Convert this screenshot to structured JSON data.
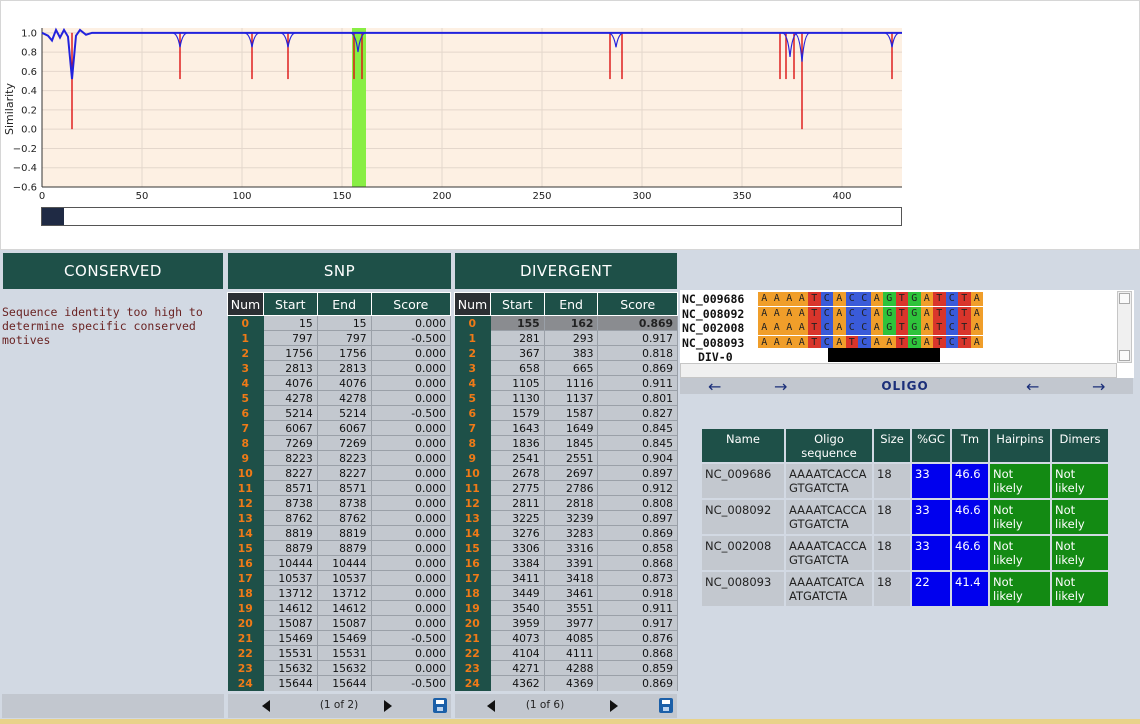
{
  "chart": {
    "ylabel": "Similarity",
    "y_ticks": [
      "1.0",
      "0.8",
      "0.6",
      "0.4",
      "0.2",
      "0.0",
      "−0.2",
      "−0.4",
      "−0.6"
    ],
    "x_ticks": [
      "0",
      "50",
      "100",
      "150",
      "200",
      "250",
      "300",
      "350",
      "400"
    ],
    "colors": {
      "plot_bg": "#fdf0e3",
      "line": "#2222dd",
      "spikes": "#dd1111",
      "highlight": "#88ee44"
    }
  },
  "chart_data": {
    "type": "line",
    "xlim": [
      0,
      430
    ],
    "ylim": [
      -0.6,
      1.05
    ],
    "grid": true,
    "highlight_range": [
      155,
      162
    ],
    "series": [
      {
        "kind": "line",
        "x": [
          0,
          3,
          5,
          7,
          9,
          11,
          13,
          15,
          17,
          19,
          22,
          25,
          430
        ],
        "values": [
          1.0,
          0.97,
          0.92,
          1.03,
          0.95,
          1.03,
          0.96,
          0.52,
          0.97,
          1.03,
          0.98,
          1.0,
          1.0
        ]
      },
      {
        "kind": "spikes",
        "x": [
          15,
          69,
          105,
          123,
          156,
          160,
          284,
          290,
          369,
          372,
          376,
          380,
          425
        ],
        "values": [
          0.0,
          0.52,
          0.52,
          0.52,
          0.52,
          0.52,
          0.52,
          0.52,
          0.52,
          0.52,
          0.52,
          0.0,
          0.52
        ]
      },
      {
        "kind": "dips",
        "x": [
          69,
          105,
          123,
          158,
          287,
          374,
          380,
          425
        ],
        "values": [
          0.85,
          0.85,
          0.85,
          0.8,
          0.85,
          0.75,
          0.7,
          0.85
        ]
      }
    ]
  },
  "sections": {
    "conserved": "CONSERVED",
    "snp": "SNP",
    "divergent": "DIVERGENT"
  },
  "conserved_note": "Sequence identity too high to determine specific conserved motives",
  "snp_table": {
    "headers": [
      "Num",
      "Start",
      "End",
      "Score"
    ],
    "rows": [
      [
        "0",
        "15",
        "15",
        "0.000"
      ],
      [
        "1",
        "797",
        "797",
        "-0.500"
      ],
      [
        "2",
        "1756",
        "1756",
        "0.000"
      ],
      [
        "3",
        "2813",
        "2813",
        "0.000"
      ],
      [
        "4",
        "4076",
        "4076",
        "0.000"
      ],
      [
        "5",
        "4278",
        "4278",
        "0.000"
      ],
      [
        "6",
        "5214",
        "5214",
        "-0.500"
      ],
      [
        "7",
        "6067",
        "6067",
        "0.000"
      ],
      [
        "8",
        "7269",
        "7269",
        "0.000"
      ],
      [
        "9",
        "8223",
        "8223",
        "0.000"
      ],
      [
        "10",
        "8227",
        "8227",
        "0.000"
      ],
      [
        "11",
        "8571",
        "8571",
        "0.000"
      ],
      [
        "12",
        "8738",
        "8738",
        "0.000"
      ],
      [
        "13",
        "8762",
        "8762",
        "0.000"
      ],
      [
        "14",
        "8819",
        "8819",
        "0.000"
      ],
      [
        "15",
        "8879",
        "8879",
        "0.000"
      ],
      [
        "16",
        "10444",
        "10444",
        "0.000"
      ],
      [
        "17",
        "10537",
        "10537",
        "0.000"
      ],
      [
        "18",
        "13712",
        "13712",
        "0.000"
      ],
      [
        "19",
        "14612",
        "14612",
        "0.000"
      ],
      [
        "20",
        "15087",
        "15087",
        "0.000"
      ],
      [
        "21",
        "15469",
        "15469",
        "-0.500"
      ],
      [
        "22",
        "15531",
        "15531",
        "0.000"
      ],
      [
        "23",
        "15632",
        "15632",
        "0.000"
      ],
      [
        "24",
        "15644",
        "15644",
        "-0.500"
      ]
    ],
    "pager": "(1 of 2)"
  },
  "divergent_table": {
    "headers": [
      "Num",
      "Start",
      "End",
      "Score"
    ],
    "rows": [
      [
        "0",
        "155",
        "162",
        "0.869"
      ],
      [
        "1",
        "281",
        "293",
        "0.917"
      ],
      [
        "2",
        "367",
        "383",
        "0.818"
      ],
      [
        "3",
        "658",
        "665",
        "0.869"
      ],
      [
        "4",
        "1105",
        "1116",
        "0.911"
      ],
      [
        "5",
        "1130",
        "1137",
        "0.801"
      ],
      [
        "6",
        "1579",
        "1587",
        "0.827"
      ],
      [
        "7",
        "1643",
        "1649",
        "0.845"
      ],
      [
        "8",
        "1836",
        "1845",
        "0.845"
      ],
      [
        "9",
        "2541",
        "2551",
        "0.904"
      ],
      [
        "10",
        "2678",
        "2697",
        "0.897"
      ],
      [
        "11",
        "2775",
        "2786",
        "0.912"
      ],
      [
        "12",
        "2811",
        "2818",
        "0.808"
      ],
      [
        "13",
        "3225",
        "3239",
        "0.897"
      ],
      [
        "14",
        "3276",
        "3283",
        "0.869"
      ],
      [
        "15",
        "3306",
        "3316",
        "0.858"
      ],
      [
        "16",
        "3384",
        "3391",
        "0.868"
      ],
      [
        "17",
        "3411",
        "3418",
        "0.873"
      ],
      [
        "18",
        "3449",
        "3461",
        "0.918"
      ],
      [
        "19",
        "3540",
        "3551",
        "0.911"
      ],
      [
        "20",
        "3959",
        "3977",
        "0.917"
      ],
      [
        "21",
        "4073",
        "4085",
        "0.876"
      ],
      [
        "22",
        "4104",
        "4111",
        "0.868"
      ],
      [
        "23",
        "4271",
        "4288",
        "0.859"
      ],
      [
        "24",
        "4362",
        "4369",
        "0.869"
      ]
    ],
    "selected_index": 0,
    "pager": "(1 of 6)"
  },
  "alignment": {
    "names": [
      "NC_009686",
      "NC_008092",
      "NC_002008",
      "NC_008093",
      "DIV-0"
    ],
    "sequences": [
      "AAAATCACCAGTGATCTA",
      "AAAATCACCAGTGATCTA",
      "AAAATCACCAGTGATCTA",
      "AAAATCATCAATGATCTA"
    ],
    "oligo_label": "OLIGO",
    "arrows": {
      "left": "←",
      "right": "→"
    }
  },
  "oligo_table": {
    "headers": {
      "name": "Name",
      "seq": "Oligo sequence",
      "size": "Size",
      "gc": "%GC",
      "tm": "Tm",
      "hairpins": "Hairpins",
      "dimers": "Dimers"
    },
    "rows": [
      {
        "name": "NC_009686",
        "seq": "AAAATCACCAGTGATCTA",
        "size": "18",
        "gc": "33",
        "tm": "46.6",
        "hairpins": "Not likely",
        "dimers": "Not likely"
      },
      {
        "name": "NC_008092",
        "seq": "AAAATCACCAGTGATCTA",
        "size": "18",
        "gc": "33",
        "tm": "46.6",
        "hairpins": "Not likely",
        "dimers": "Not likely"
      },
      {
        "name": "NC_002008",
        "seq": "AAAATCACCAGTGATCTA",
        "size": "18",
        "gc": "33",
        "tm": "46.6",
        "hairpins": "Not likely",
        "dimers": "Not likely"
      },
      {
        "name": "NC_008093",
        "seq": "AAAATCATCAATGATCTA",
        "size": "18",
        "gc": "22",
        "tm": "41.4",
        "hairpins": "Not likely",
        "dimers": "Not likely"
      }
    ]
  }
}
